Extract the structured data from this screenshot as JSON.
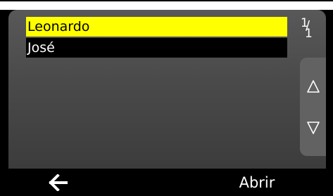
{
  "list": {
    "items": [
      {
        "label": "Leonardo",
        "selected": true
      },
      {
        "label": "José",
        "selected": false
      }
    ]
  },
  "pagination": {
    "current": "1",
    "total": "1"
  },
  "scroll": {
    "up_icon": "triangle-up-outline-icon",
    "down_icon": "triangle-down-outline-icon"
  },
  "bottom_bar": {
    "back_icon": "arrow-left-icon",
    "open_label": "Abrir"
  },
  "colors": {
    "selection": "#ffff00",
    "panel": "#4a4a4a",
    "bar": "#000000",
    "text": "#ffffff"
  }
}
